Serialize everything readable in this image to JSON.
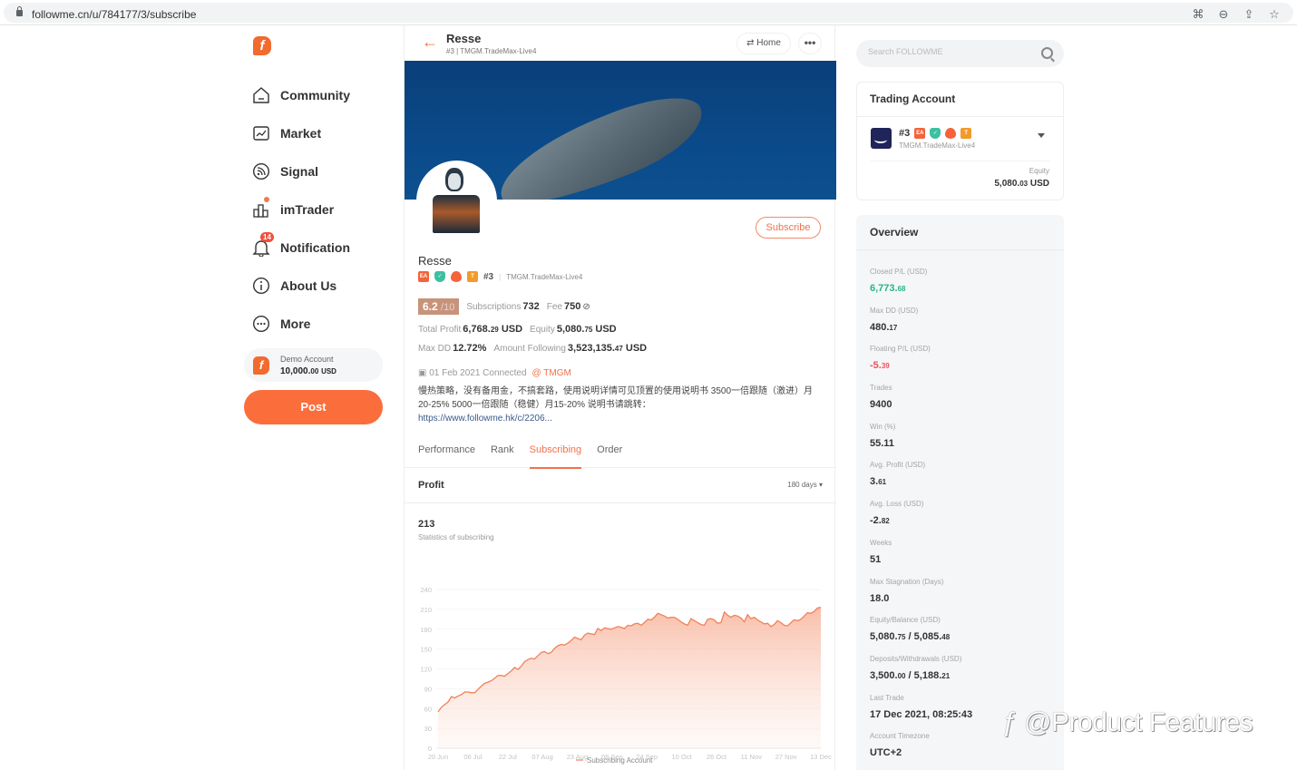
{
  "browser": {
    "url": "followme.cn/u/784177/3/subscribe",
    "icons": [
      "translate-icon",
      "zoom-out-icon",
      "share-icon",
      "bookmark-star-icon"
    ]
  },
  "sidebar": {
    "logo": "f",
    "items": [
      {
        "label": "Community",
        "icon": "home-icon"
      },
      {
        "label": "Market",
        "icon": "chart-icon"
      },
      {
        "label": "Signal",
        "icon": "signal-icon"
      },
      {
        "label": "imTrader",
        "icon": "bar-chart-icon"
      },
      {
        "label": "Notification",
        "icon": "bell-icon",
        "badge": "14"
      },
      {
        "label": "About Us",
        "icon": "info-icon"
      },
      {
        "label": "More",
        "icon": "more-icon"
      }
    ],
    "demo_account": {
      "label": "Demo Account",
      "value_int": "10,000.",
      "value_dec": "00",
      "currency": "USD"
    },
    "post_label": "Post"
  },
  "header": {
    "name": "Resse",
    "subtitle": "#3 | TMGM.TradeMax-Live4",
    "home_label": "Home",
    "more_label": "•••"
  },
  "profile": {
    "subscribe_label": "Subscribe",
    "name": "Resse",
    "tags": [
      "EA",
      "verified",
      "hot",
      "T"
    ],
    "rank": "#3",
    "account": "TMGM.TradeMax-Live4",
    "score": "6.2",
    "score_max": "/10",
    "subscriptions_label": "Subscriptions",
    "subscriptions": "732",
    "fee_label": "Fee",
    "fee": "750",
    "total_profit_label": "Total Profit",
    "total_profit_int": "6,768.",
    "total_profit_dec": "29",
    "equity_label": "Equity",
    "equity_int": "5,080.",
    "equity_dec": "75",
    "max_dd_label": "Max DD",
    "max_dd": "12.72%",
    "amount_following_label": "Amount Following",
    "amount_following_int": "3,523,135.",
    "amount_following_dec": "47",
    "currency": "USD",
    "connected": "01 Feb 2021 Connected",
    "broker": "@ TMGM",
    "description": "慢热策略，没有备用金，不搞套路，使用说明详情可见顶置的使用说明书 3500一倍跟随（激进）月20-25% 5000一倍跟随（稳健）月15-20% 说明书请跳转：",
    "link": "https://www.followme.hk/c/2206..."
  },
  "tabs": [
    {
      "label": "Performance",
      "active": false
    },
    {
      "label": "Rank",
      "active": false
    },
    {
      "label": "Subscribing",
      "active": true
    },
    {
      "label": "Order",
      "active": false
    }
  ],
  "profit": {
    "title": "Profit",
    "range": "180 days",
    "stat_value": "213",
    "stat_label": "Statistics of subscribing"
  },
  "chart_data": {
    "type": "area",
    "title": "",
    "xlabel": "",
    "ylabel": "",
    "ylim": [
      0,
      240
    ],
    "yticks": [
      "0",
      "30",
      "60",
      "90",
      "120",
      "150",
      "180",
      "210",
      "240"
    ],
    "xticks": [
      "20 Jun",
      "06 Jul",
      "22 Jul",
      "07 Aug",
      "23 Aug",
      "08 Sep",
      "24 Sep",
      "10 Oct",
      "26 Oct",
      "11 Nov",
      "27 Nov",
      "13 Dec"
    ],
    "grid": true,
    "legend": "bottom-center",
    "series": [
      {
        "name": "Subscribing Account",
        "color": "#f2805a",
        "values": [
          55,
          62,
          66,
          70,
          78,
          76,
          79,
          81,
          85,
          85,
          84,
          84,
          89,
          94,
          98,
          100,
          102,
          106,
          110,
          110,
          109,
          113,
          117,
          122,
          119,
          124,
          131,
          134,
          136,
          135,
          140,
          145,
          146,
          143,
          145,
          151,
          155,
          157,
          156,
          159,
          163,
          168,
          166,
          164,
          171,
          174,
          173,
          172,
          181,
          178,
          182,
          181,
          180,
          182,
          184,
          183,
          181,
          186,
          185,
          188,
          189,
          186,
          190,
          195,
          194,
          198,
          204,
          202,
          200,
          197,
          198,
          198,
          195,
          191,
          188,
          186,
          196,
          193,
          190,
          187,
          186,
          195,
          196,
          194,
          189,
          190,
          206,
          201,
          198,
          201,
          200,
          197,
          191,
          202,
          196,
          198,
          194,
          191,
          188,
          189,
          184,
          187,
          193,
          190,
          186,
          185,
          190,
          194,
          193,
          195,
          200,
          205,
          204,
          207,
          212,
          213
        ]
      }
    ]
  },
  "right": {
    "search_placeholder": "Search FOLLOWME",
    "trading_account": {
      "title": "Trading Account",
      "rank": "#3",
      "tags": [
        "EA",
        "verified",
        "hot",
        "T"
      ],
      "account": "TMGM.TradeMax-Live4",
      "equity_label": "Equity",
      "equity_int": "5,080.",
      "equity_dec": "03",
      "currency": "USD"
    },
    "overview": {
      "title": "Overview",
      "items": [
        {
          "label": "Closed P/L (USD)",
          "int": "6,773.",
          "dec": "68",
          "tone": "green"
        },
        {
          "label": "Max DD (USD)",
          "int": "480.",
          "dec": "17",
          "tone": ""
        },
        {
          "label": "Floating P/L (USD)",
          "int": "-5.",
          "dec": "39",
          "tone": "red"
        },
        {
          "label": "Trades",
          "int": "9400",
          "dec": "",
          "tone": ""
        },
        {
          "label": "Win (%)",
          "int": "55.11",
          "dec": "",
          "tone": ""
        },
        {
          "label": "Avg. Profit (USD)",
          "int": "3.",
          "dec": "61",
          "tone": ""
        },
        {
          "label": "Avg. Loss (USD)",
          "int": "-2.",
          "dec": "82",
          "tone": ""
        },
        {
          "label": "Weeks",
          "int": "51",
          "dec": "",
          "tone": ""
        },
        {
          "label": "Max Stagnation (Days)",
          "int": "18.0",
          "dec": "",
          "tone": ""
        },
        {
          "label": "Equity/Balance (USD)",
          "int": "5,080.",
          "dec": "75",
          "int2": " / 5,085.",
          "dec2": "48",
          "tone": ""
        },
        {
          "label": "Deposits/Withdrawals (USD)",
          "int": "3,500.",
          "dec": "00",
          "int2": " / 5,188.",
          "dec2": "21",
          "tone": ""
        },
        {
          "label": "Last Trade",
          "int": "17 Dec 2021, 08:25:43",
          "dec": "",
          "tone": ""
        },
        {
          "label": "Account Timezone",
          "int": "UTC+2",
          "dec": "",
          "tone": ""
        }
      ]
    }
  },
  "watermark": "@Product Features"
}
